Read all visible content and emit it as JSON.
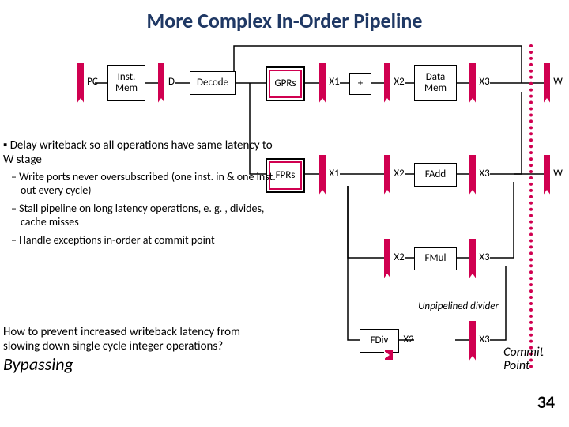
{
  "title": "More Complex In-Order Pipeline",
  "stages": {
    "pc": "PC",
    "imem": "Inst.\nMem",
    "d": "D",
    "decode": "Decode",
    "gprs": "GPRs",
    "fprs": "FPRs",
    "x1": "X1",
    "plus": "+",
    "x2": "X2",
    "dmem": "Data\nMem",
    "x3": "X3",
    "w": "W",
    "fadd": "FAdd",
    "fmul": "FMul",
    "unp": "Unpipelined divider",
    "fdiv": "FDiv"
  },
  "bullets": {
    "head": "Delay writeback so all operations have same latency to W stage",
    "items": [
      "Write ports never oversubscribed (one inst. in & one inst. out every cycle)",
      "Stall pipeline on long latency operations, e. g. , divides, cache misses",
      "Handle exceptions in-order at commit point"
    ]
  },
  "question": "How to prevent increased writeback latency from slowing down single cycle integer operations?",
  "answer": "Bypassing",
  "commit": "Commit\nPoint",
  "page": "34"
}
